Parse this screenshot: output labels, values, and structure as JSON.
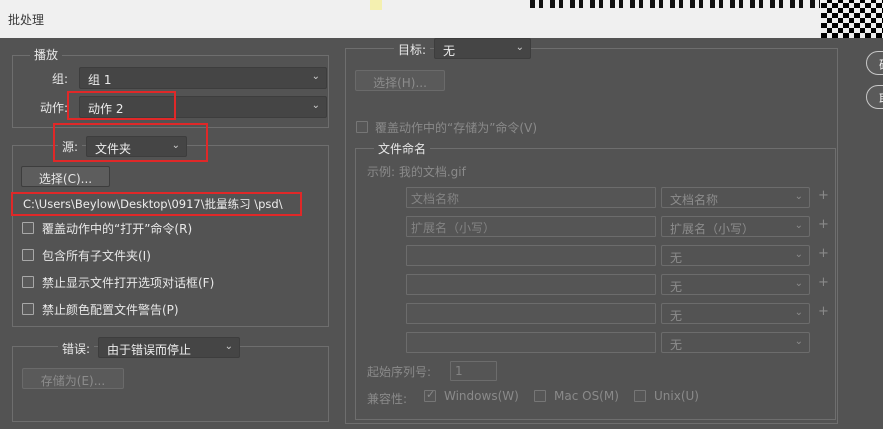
{
  "window": {
    "title": "批处理"
  },
  "play": {
    "title": "播放",
    "set_label": "组:",
    "set_value": "组 1",
    "action_label": "动作:",
    "action_value": "动作 2"
  },
  "source": {
    "label": "源:",
    "value": "文件夹",
    "choose_button": "选择(C)...",
    "path": "C:\\Users\\Beylow\\Desktop\\0917\\批量练习 \\psd\\",
    "options": [
      {
        "label": "覆盖动作中的“打开”命令(R)",
        "checked": false
      },
      {
        "label": "包含所有子文件夹(I)",
        "checked": false
      },
      {
        "label": "禁止显示文件打开选项对话框(F)",
        "checked": false
      },
      {
        "label": "禁止颜色配置文件警告(P)",
        "checked": false
      }
    ]
  },
  "errors": {
    "label": "错误:",
    "value": "由于错误而停止",
    "save_as_button": "存储为(E)..."
  },
  "destination": {
    "label": "目标:",
    "value": "无",
    "choose_button": "选择(H)...",
    "override_save_as": "覆盖动作中的“存储为”命令(V)"
  },
  "file_naming": {
    "title": "文件命名",
    "example": "示例: 我的文档.gif",
    "rows": [
      {
        "text": "文档名称",
        "select": "文档名称"
      },
      {
        "text": "扩展名（小写）",
        "select": "扩展名（小写）"
      },
      {
        "text": "",
        "select": "无"
      },
      {
        "text": "",
        "select": "无"
      },
      {
        "text": "",
        "select": "无"
      },
      {
        "text": "",
        "select": "无"
      }
    ],
    "plus": "+",
    "serial_label": "起始序列号:",
    "serial_value": "1",
    "compat_label": "兼容性:",
    "compat_windows": "Windows(W)",
    "compat_mac": "Mac OS(M)",
    "compat_unix": "Unix(U)",
    "compat_windows_checked": true,
    "compat_mac_checked": false,
    "compat_unix_checked": false
  },
  "side_buttons": {
    "ok": "确",
    "cancel": "取"
  },
  "colors": {
    "dialog_bg": "#535353",
    "highlight": "#e02828"
  }
}
